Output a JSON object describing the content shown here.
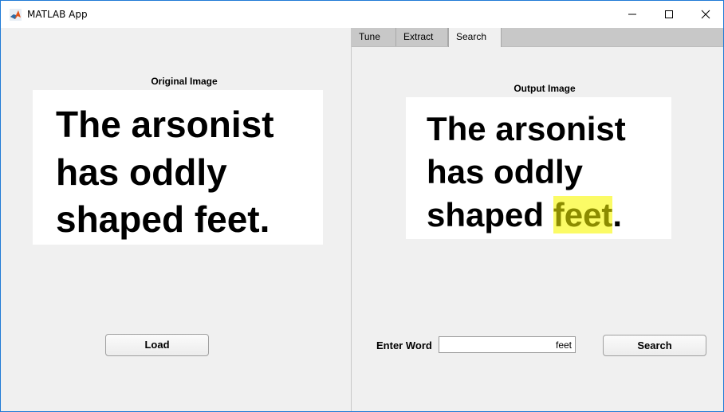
{
  "window": {
    "title": "MATLAB App"
  },
  "tabs": [
    {
      "label": "Tune",
      "selected": false
    },
    {
      "label": "Extract",
      "selected": false
    },
    {
      "label": "Search",
      "selected": true
    }
  ],
  "left_panel": {
    "axes_title": "Original Image",
    "image_lines": [
      "The arsonist",
      "has oddly",
      "shaped feet."
    ],
    "load_button": "Load"
  },
  "right_panel": {
    "axes_title": "Output Image",
    "image_lines": {
      "line1": "The arsonist",
      "line2": "has oddly",
      "line3_prefix": "shaped ",
      "line3_highlight": "feet",
      "line3_suffix": "."
    },
    "enter_word_label": "Enter Word",
    "word_value": "feet",
    "search_button": "Search"
  },
  "colors": {
    "highlight": "#fbfb66",
    "highlight_text": "#8c8c00",
    "window_border": "#1f7ad6",
    "panel_bg": "#f0f0f0"
  }
}
